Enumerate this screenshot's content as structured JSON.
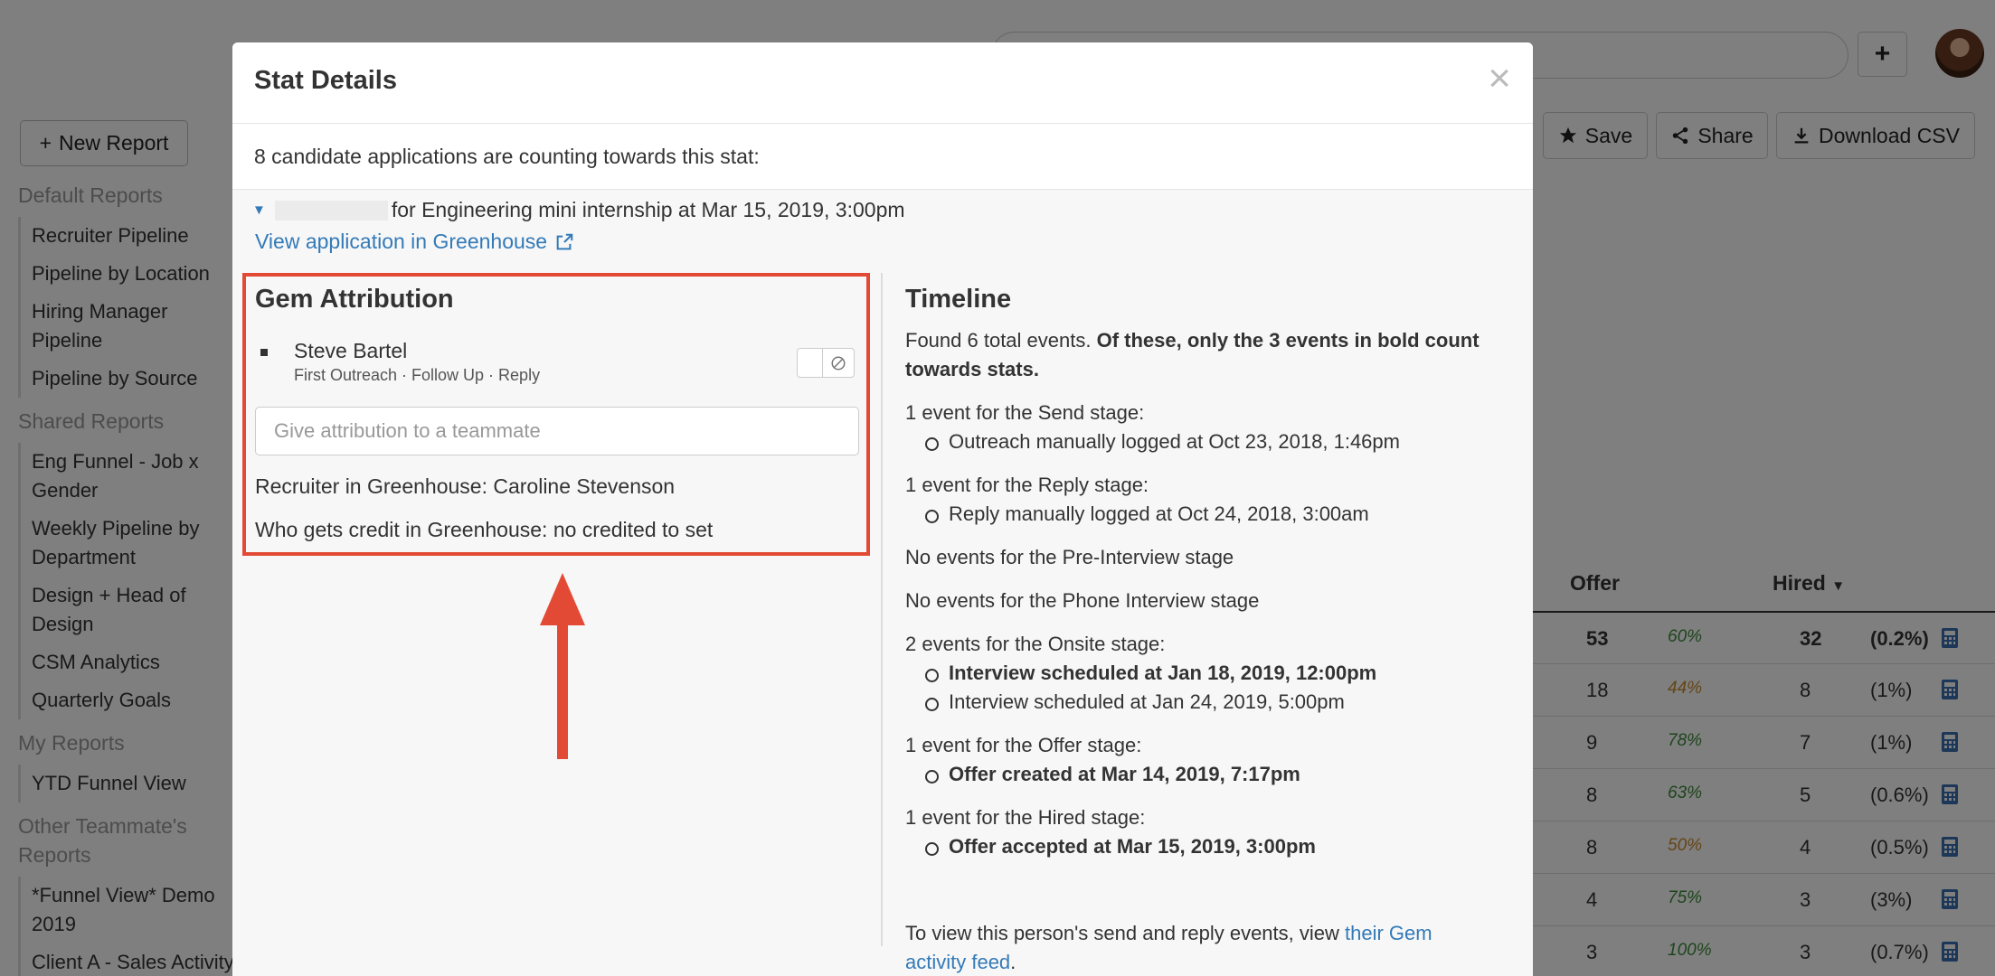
{
  "background": {
    "new_report_label": "New Report",
    "sidebar": {
      "sections": [
        {
          "title": "Default Reports",
          "items": [
            "Recruiter Pipeline",
            "Pipeline by Location",
            "Hiring Manager Pipeline",
            "Pipeline by Source"
          ]
        },
        {
          "title": "Shared Reports",
          "items": [
            "Eng Funnel - Job x Gender",
            "Weekly Pipeline by Department",
            "Design + Head of Design",
            "CSM Analytics",
            "Quarterly Goals"
          ]
        },
        {
          "title": "My Reports",
          "items": [
            "YTD Funnel View"
          ]
        },
        {
          "title": "Other Teammate's Reports",
          "items": [
            "*Funnel View* Demo 2019",
            "Client A - Sales Activity"
          ]
        }
      ]
    },
    "toolbar": {
      "save_label": "Save",
      "share_label": "Share",
      "download_label": "Download CSV"
    },
    "table": {
      "headers": {
        "offer": "Offer",
        "hired": "Hired"
      },
      "rows": [
        {
          "offer": "53",
          "pct": "60%",
          "hired": "32",
          "ratio": "(0.2%)",
          "bold": true,
          "color": "#3a8a3a"
        },
        {
          "offer": "18",
          "pct": "44%",
          "hired": "8",
          "ratio": "(1%)",
          "bold": false,
          "color": "#c98a2e"
        },
        {
          "offer": "9",
          "pct": "78%",
          "hired": "7",
          "ratio": "(1%)",
          "bold": false,
          "color": "#3a8a3a"
        },
        {
          "offer": "8",
          "pct": "63%",
          "hired": "5",
          "ratio": "(0.6%)",
          "bold": false,
          "color": "#3a8a3a"
        },
        {
          "offer": "8",
          "pct": "50%",
          "hired": "4",
          "ratio": "(0.5%)",
          "bold": false,
          "color": "#c98a2e"
        },
        {
          "offer": "4",
          "pct": "75%",
          "hired": "3",
          "ratio": "(3%)",
          "bold": false,
          "color": "#3a8a3a"
        },
        {
          "offer": "3",
          "pct": "100%",
          "hired": "3",
          "ratio": "(0.7%)",
          "bold": false,
          "color": "#3a8a3a"
        }
      ]
    }
  },
  "modal": {
    "title": "Stat Details",
    "close_label": "×",
    "subheader": "8 candidate applications are counting towards this stat:",
    "application": {
      "text": "for Engineering mini internship at Mar 15, 2019, 3:00pm",
      "view_link": "View application in Greenhouse"
    },
    "attribution": {
      "title": "Gem Attribution",
      "person": "Steve Bartel",
      "stages": "First Outreach · Follow Up · Reply",
      "input_placeholder": "Give attribution to a teammate",
      "recruiter_line": "Recruiter in Greenhouse: Caroline Stevenson",
      "credit_line": "Who gets credit in Greenhouse: no credited to set"
    },
    "timeline": {
      "title": "Timeline",
      "summary_normal": "Found 6 total events. ",
      "summary_bold": "Of these, only the 3 events in bold count towards stats.",
      "send_stage": "1 event for the Send stage:",
      "send_event": "Outreach manually logged at Oct 23, 2018, 1:46pm",
      "reply_stage": "1 event for the Reply stage:",
      "reply_event": "Reply manually logged at Oct 24, 2018, 3:00am",
      "pre_interview": "No events for the Pre-Interview stage",
      "phone_interview": "No events for the Phone Interview stage",
      "onsite_stage": "2 events for the Onsite stage:",
      "onsite_event_1": "Interview scheduled at Jan 18, 2019, 12:00pm",
      "onsite_event_2": "Interview scheduled at Jan 24, 2019, 5:00pm",
      "offer_stage": "1 event for the Offer stage:",
      "offer_event": "Offer created at Mar 14, 2019, 7:17pm",
      "hired_stage": "1 event for the Hired stage:",
      "hired_event": "Offer accepted at Mar 15, 2019, 3:00pm",
      "footer_prefix": "To view this person's send and reply events, view ",
      "footer_link": "their Gem activity feed",
      "footer_suffix": "."
    }
  },
  "colors": {
    "highlight": "#e34a35",
    "link": "#337ab7"
  }
}
